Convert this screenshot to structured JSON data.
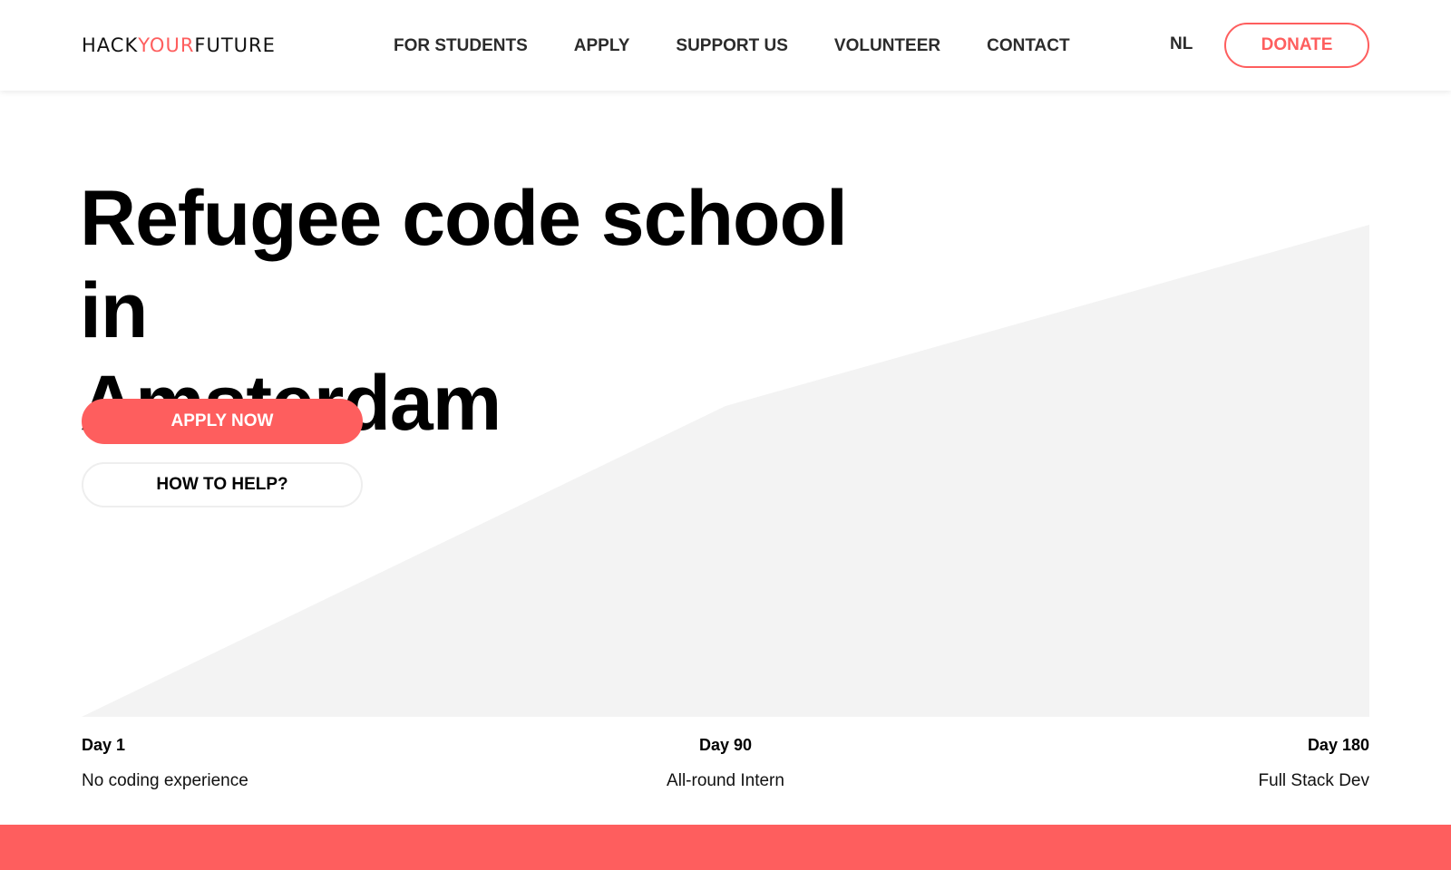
{
  "header": {
    "logo": {
      "part1": "HACK",
      "part2": "YOUR",
      "part3": "FUTURE"
    },
    "nav": [
      {
        "label": "FOR STUDENTS"
      },
      {
        "label": "APPLY"
      },
      {
        "label": "SUPPORT US"
      },
      {
        "label": "VOLUNTEER"
      },
      {
        "label": "CONTACT"
      }
    ],
    "lang_label": "NL",
    "donate_label": "DONATE"
  },
  "hero": {
    "title_line1": "Refugee code school in",
    "title_line2": "Amsterdam",
    "apply_label": "APPLY NOW",
    "help_label": "HOW TO HELP?"
  },
  "timeline": [
    {
      "day": "Day 1",
      "desc": "No coding experience"
    },
    {
      "day": "Day 90",
      "desc": "All-round Intern"
    },
    {
      "day": "Day 180",
      "desc": "Full Stack Dev"
    }
  ],
  "colors": {
    "accent": "#fe5e5e",
    "graph_fill": "#f3f3f3",
    "text": "#000000"
  },
  "icons": {
    "graph": "growth-area-graph"
  }
}
